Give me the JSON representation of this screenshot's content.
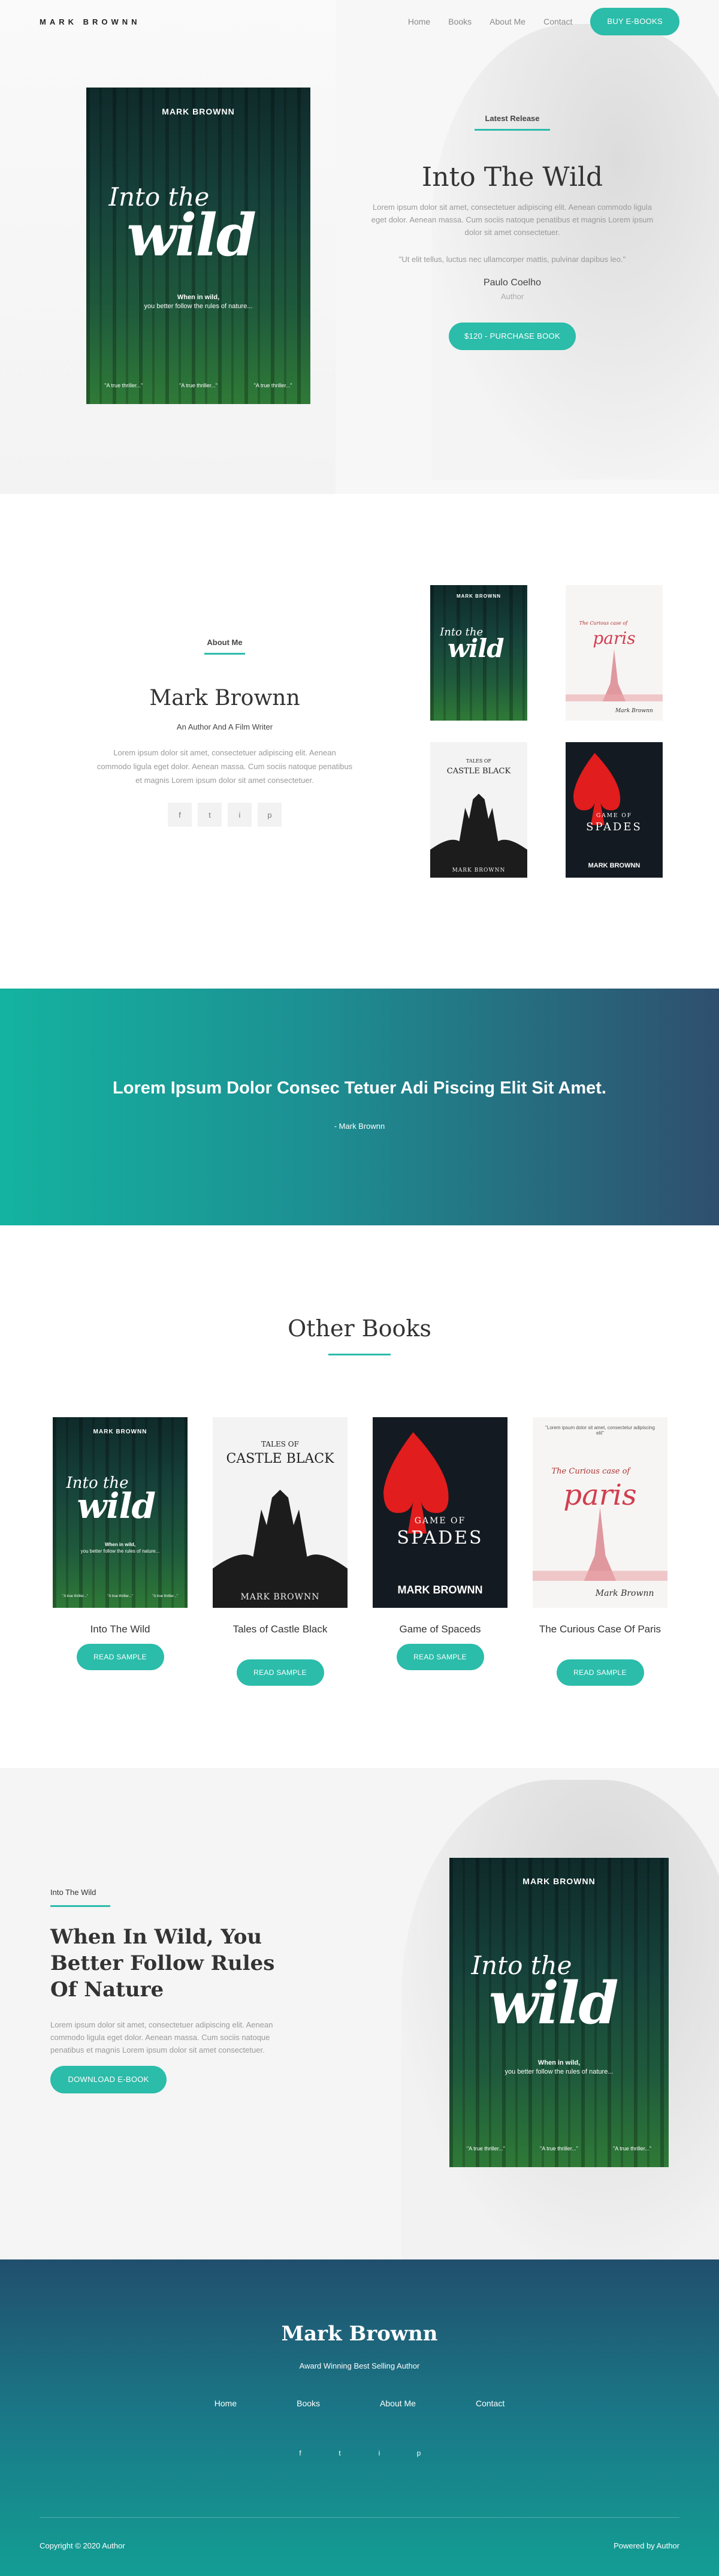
{
  "header": {
    "logo": "MARK BROWNN",
    "nav": [
      "Home",
      "Books",
      "About Me",
      "Contact"
    ],
    "cta": "BUY E-BOOKS"
  },
  "covers": {
    "wild": {
      "author": "MARK BROWNN",
      "into": "Into the",
      "big": "wild",
      "tagline1": "When in wild,",
      "tagline2": "you better follow the rules of nature...",
      "quotes": [
        "\"A true thriller...\"",
        "\"A true thriller...\"",
        "\"A true thriller...\""
      ]
    },
    "castle": {
      "top": "TALES OF",
      "title": "CASTLE BLACK",
      "author": "MARK BROWNN"
    },
    "spades": {
      "top": "GAME OF",
      "title": "SPADES",
      "author": "MARK BROWNN"
    },
    "paris": {
      "quote": "\"Lorem ipsum dolor sit amet, consectetur adipiscing elit\"",
      "top": "The Curious case of",
      "title": "paris",
      "author": "Mark Brownn"
    }
  },
  "hero": {
    "label": "Latest Release",
    "title": "Into The Wild",
    "desc": "Lorem ipsum dolor sit amet, consectetuer adipiscing elit. Aenean commodo ligula eget dolor. Aenean massa. Cum sociis natoque penatibus et magnis Lorem ipsum dolor sit amet consectetuer.",
    "quote": "\"Ut elit tellus, luctus nec ullamcorper mattis, pulvinar dapibus leo.\"",
    "author": "Paulo Coelho",
    "role": "Author",
    "button": "$120 - PURCHASE BOOK"
  },
  "about": {
    "label": "About Me",
    "name": "Mark Brownn",
    "sub": "An Author And A Film Writer",
    "desc": "Lorem ipsum dolor sit amet, consectetuer adipiscing elit. Aenean commodo ligula eget dolor. Aenean massa. Cum sociis natoque penatibus et magnis Lorem ipsum dolor sit amet consectetuer.",
    "socials": [
      "f",
      "t",
      "i",
      "p"
    ]
  },
  "banner": {
    "quote": "Lorem Ipsum Dolor Consec Tetuer Adi Piscing Elit Sit Amet.",
    "by": "- Mark Brownn"
  },
  "other": {
    "title": "Other Books",
    "books": [
      {
        "title": "Into The Wild",
        "button": "READ SAMPLE"
      },
      {
        "title": "Tales of Castle Black",
        "button": "READ SAMPLE"
      },
      {
        "title": "Game of Spaceds",
        "button": "READ SAMPLE"
      },
      {
        "title": "The Curious Case Of Paris",
        "button": "READ SAMPLE"
      }
    ]
  },
  "feature": {
    "label": "Into The Wild",
    "title": "When In Wild, You Better Follow Rules Of Nature",
    "desc": "Lorem ipsum dolor sit amet, consectetuer adipiscing elit. Aenean commodo ligula eget dolor. Aenean massa. Cum sociis natoque penatibus et magnis Lorem ipsum dolor sit amet consectetuer.",
    "button": "DOWNLOAD E-BOOK"
  },
  "footer": {
    "name": "Mark Brownn",
    "tag": "Award Winning Best Selling Author",
    "nav": [
      "Home",
      "Books",
      "About Me",
      "Contact"
    ],
    "socials": [
      "f",
      "t",
      "i",
      "p"
    ],
    "copyright": "Copyright © 2020 Author",
    "powered": "Powered by Author"
  },
  "colors": {
    "accent": "#2bbcaa",
    "dark": "#333333"
  }
}
